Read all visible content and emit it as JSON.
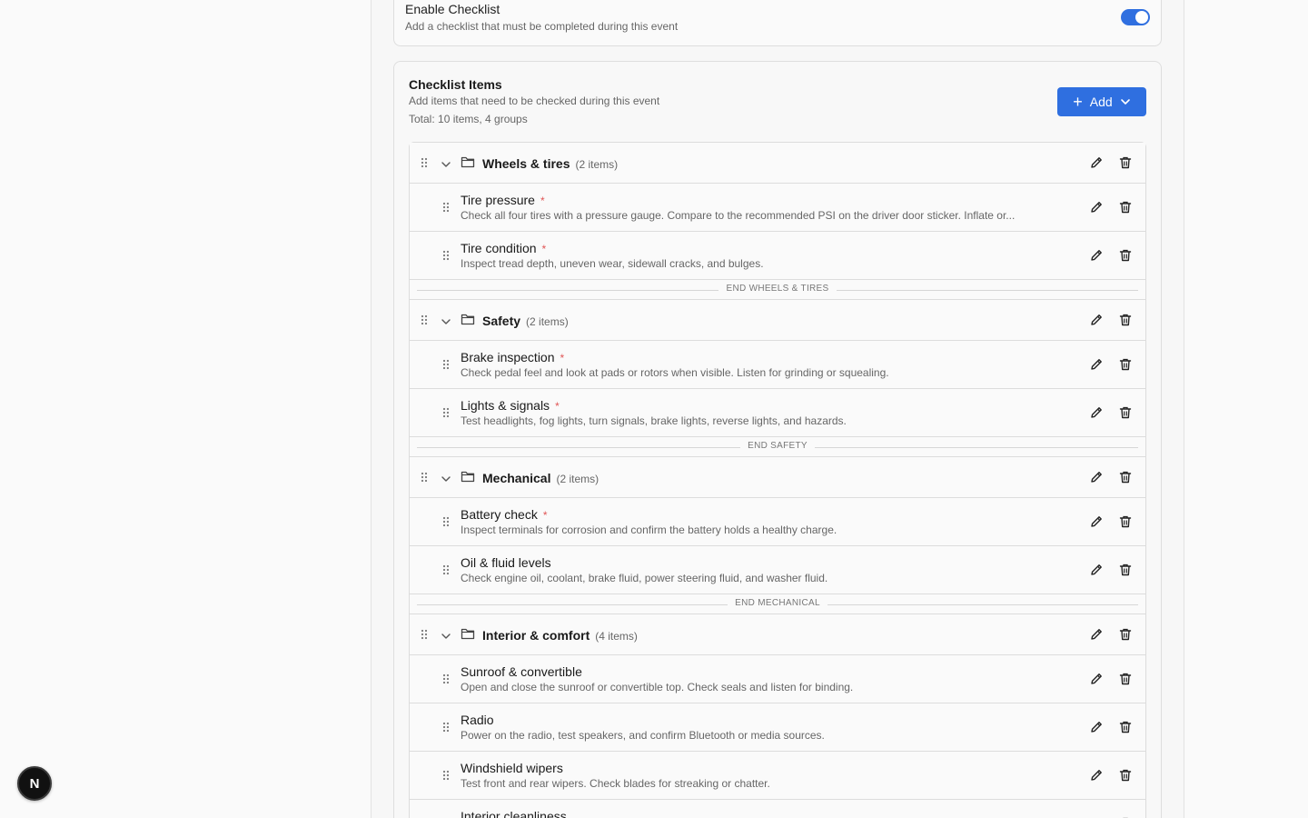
{
  "enable_checklist": {
    "title": "Enable Checklist",
    "description": "Add a checklist that must be completed during this event",
    "enabled": true
  },
  "checklist": {
    "title": "Checklist Items",
    "subtitle": "Add items that need to be checked during this event",
    "total": "Total: 10 items, 4 groups",
    "add_label": "Add",
    "groups": [
      {
        "name": "Wheels & tires",
        "count": "(2 items)",
        "end_label": "END WHEELS & TIRES",
        "items": [
          {
            "title": "Tire pressure",
            "required": "*",
            "desc": "Check all four tires with a pressure gauge. Compare to the recommended PSI on the driver door sticker. Inflate or..."
          },
          {
            "title": "Tire condition",
            "required": "*",
            "desc": "Inspect tread depth, uneven wear, sidewall cracks, and bulges."
          }
        ]
      },
      {
        "name": "Safety",
        "count": "(2 items)",
        "end_label": "END SAFETY",
        "items": [
          {
            "title": "Brake inspection",
            "required": "*",
            "desc": "Check pedal feel and look at pads or rotors when visible. Listen for grinding or squealing."
          },
          {
            "title": "Lights & signals",
            "required": "*",
            "desc": "Test headlights, fog lights, turn signals, brake lights, reverse lights, and hazards."
          }
        ]
      },
      {
        "name": "Mechanical",
        "count": "(2 items)",
        "end_label": "END MECHANICAL",
        "items": [
          {
            "title": "Battery check",
            "required": "*",
            "desc": "Inspect terminals for corrosion and confirm the battery holds a healthy charge."
          },
          {
            "title": "Oil & fluid levels",
            "required": "",
            "desc": "Check engine oil, coolant, brake fluid, power steering fluid, and washer fluid."
          }
        ]
      },
      {
        "name": "Interior & comfort",
        "count": "(4 items)",
        "end_label": "",
        "items": [
          {
            "title": "Sunroof & convertible",
            "required": "",
            "desc": "Open and close the sunroof or convertible top. Check seals and listen for binding."
          },
          {
            "title": "Radio",
            "required": "",
            "desc": "Power on the radio, test speakers, and confirm Bluetooth or media sources."
          },
          {
            "title": "Windshield wipers",
            "required": "",
            "desc": "Test front and rear wipers. Check blades for streaking or chatter."
          },
          {
            "title": "Interior cleanliness",
            "required": "",
            "desc": ""
          }
        ]
      }
    ]
  },
  "dev_badge": "N",
  "colors": {
    "accent": "#2f6fe0",
    "required": "#e05555"
  },
  "icons": [
    "drag-handle-icon",
    "chevron-down-icon",
    "folder-icon",
    "pencil-icon",
    "trash-icon",
    "plus-icon"
  ]
}
